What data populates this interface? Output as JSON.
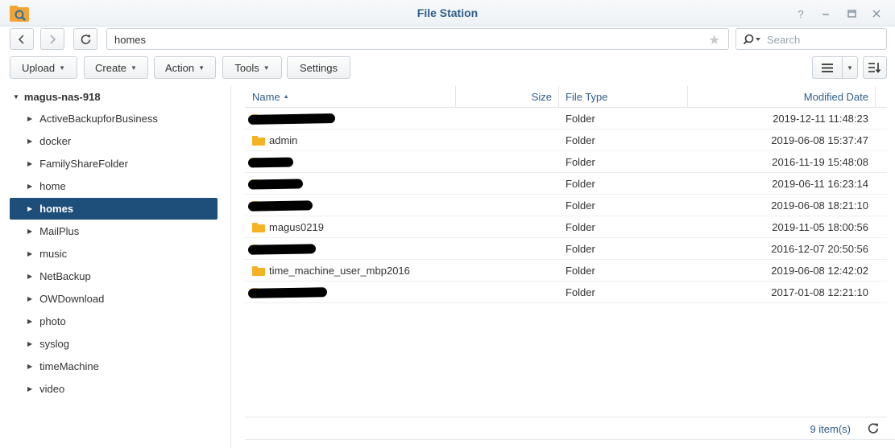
{
  "window": {
    "title": "File Station"
  },
  "address": {
    "path": "homes",
    "search_placeholder": "Search"
  },
  "toolbar": {
    "upload": "Upload",
    "create": "Create",
    "action": "Action",
    "tools": "Tools",
    "settings": "Settings"
  },
  "sidebar": {
    "root": "magus-nas-918",
    "items": [
      {
        "label": "ActiveBackupforBusiness"
      },
      {
        "label": "docker"
      },
      {
        "label": "FamilyShareFolder"
      },
      {
        "label": "home"
      },
      {
        "label": "homes",
        "selected": true
      },
      {
        "label": "MailPlus"
      },
      {
        "label": "music"
      },
      {
        "label": "NetBackup"
      },
      {
        "label": "OWDownload"
      },
      {
        "label": "photo"
      },
      {
        "label": "syslog"
      },
      {
        "label": "timeMachine"
      },
      {
        "label": "video"
      }
    ]
  },
  "list": {
    "columns": {
      "name": "Name",
      "size": "Size",
      "type": "File Type",
      "modified": "Modified Date"
    },
    "rows": [
      {
        "name": "",
        "type": "Folder",
        "modified": "2019-12-11 11:48:23",
        "redacted": true
      },
      {
        "name": "admin",
        "type": "Folder",
        "modified": "2019-06-08 15:37:47",
        "redacted": false
      },
      {
        "name": "",
        "type": "Folder",
        "modified": "2016-11-19 15:48:08",
        "redacted": true
      },
      {
        "name": "",
        "type": "Folder",
        "modified": "2019-06-11 16:23:14",
        "redacted": true
      },
      {
        "name": "",
        "type": "Folder",
        "modified": "2019-06-08 18:21:10",
        "redacted": true
      },
      {
        "name": "magus0219",
        "type": "Folder",
        "modified": "2019-11-05 18:00:56",
        "redacted": false
      },
      {
        "name": "",
        "type": "Folder",
        "modified": "2016-12-07 20:50:56",
        "redacted": true
      },
      {
        "name": "time_machine_user_mbp2016",
        "type": "Folder",
        "modified": "2019-06-08 12:42:02",
        "redacted": false
      },
      {
        "name": "",
        "type": "Folder",
        "modified": "2017-01-08 12:21:10",
        "redacted": true
      }
    ]
  },
  "status": {
    "count": "9 item(s)"
  },
  "colors": {
    "accent": "#2f5d8a",
    "selected_bg": "#1e4e7a",
    "folder": "#f5b323"
  }
}
